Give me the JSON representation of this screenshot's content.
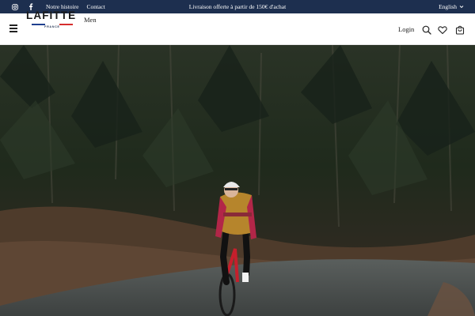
{
  "topbar": {
    "links": [
      {
        "label": "Notre histoire"
      },
      {
        "label": "Contact"
      }
    ],
    "announcement": "Livraison offerte à partir de 150€ d'achat",
    "language": "English",
    "icons": {
      "instagram": "instagram-icon",
      "facebook": "facebook-icon",
      "chevron": "chevron-down-icon"
    },
    "bg_color": "#1d2f4f"
  },
  "header": {
    "logo_text": "LAFITTE",
    "logo_sub": "FRANCE",
    "menu_label": "Men",
    "login_label": "Login",
    "icons": {
      "menu": "hamburger-menu-icon",
      "search": "search-icon",
      "wishlist": "heart-icon",
      "cart": "shopping-bag-icon"
    },
    "flag_colors": [
      "#1f3f8f",
      "#ffffff",
      "#d62d2d"
    ]
  },
  "hero": {
    "image": "cyclist climbing a forest road in a red and ochre jersey"
  }
}
